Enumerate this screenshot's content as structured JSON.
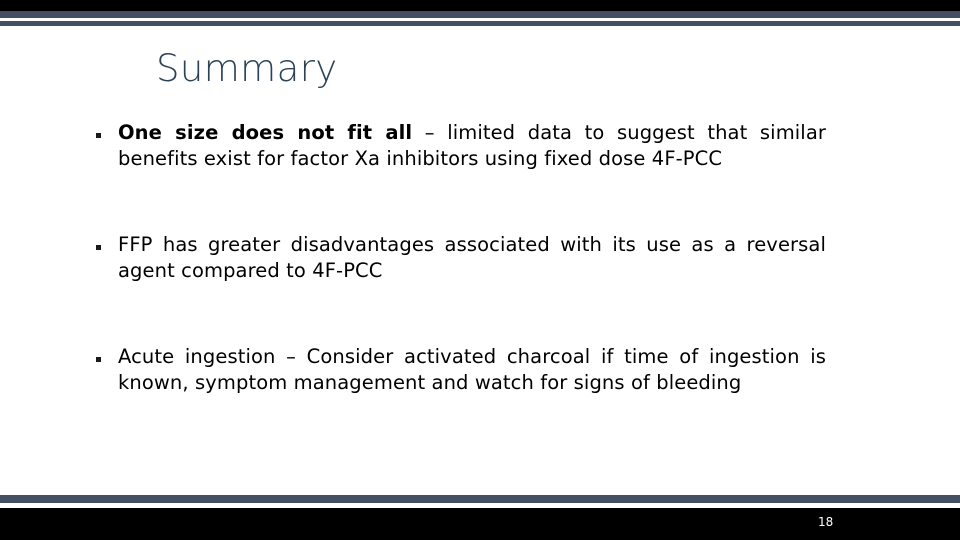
{
  "slide": {
    "title": "Summary",
    "page_number": "18",
    "colors": {
      "accent_slate": "#444f63",
      "title_text": "#2c4257",
      "band_black": "#000000",
      "body_text": "#000000",
      "background": "#ffffff"
    },
    "bullets": [
      {
        "marker": "square-bullet",
        "lead": "One size does not fit all",
        "rest": " – limited data to suggest that similar benefits exist for factor Xa inhibitors using fixed dose 4F-PCC",
        "full_text": "One size does not fit all – limited data to suggest that similar benefits exist for factor Xa inhibitors using fixed dose 4F-PCC"
      },
      {
        "marker": "square-bullet",
        "lead": "",
        "rest": "FFP has greater disadvantages associated with its use as a reversal agent compared to 4F-PCC",
        "full_text": "FFP has greater disadvantages associated with its use as a reversal agent compared to 4F-PCC"
      },
      {
        "marker": "square-bullet",
        "lead": "",
        "rest": "Acute ingestion – Consider activated charcoal if time of ingestion is known, symptom management and watch for signs of bleeding",
        "full_text": "Acute ingestion – Consider activated charcoal if time of ingestion is known, symptom management and watch for signs of bleeding"
      }
    ]
  }
}
